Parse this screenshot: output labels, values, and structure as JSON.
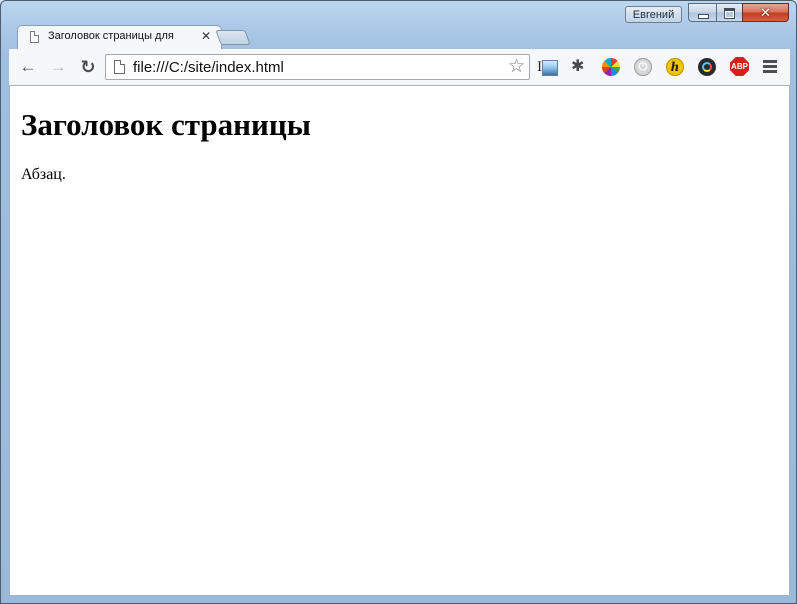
{
  "window": {
    "profile_name": "Евгений",
    "close_glyph": "✕"
  },
  "tabs": [
    {
      "title": "Заголовок страницы для",
      "active": true
    }
  ],
  "toolbar": {
    "back_glyph": "←",
    "forward_glyph": "→",
    "reload_glyph": "↻",
    "url": "file:///C:/site/index.html",
    "bookmark_glyph": "☆",
    "extensions": [
      "image-icon",
      "bug-icon",
      "color-wheel-icon",
      "power-icon",
      "hint-icon",
      "circle-icon",
      "adblock-icon"
    ],
    "abp_label": "ABP",
    "hint_label": "h"
  },
  "page": {
    "heading": "Заголовок страницы",
    "paragraph": "Абзац."
  },
  "colors": {
    "frame": "#a9c7e6",
    "close_button": "#c43e22",
    "abp_red": "#d71f1f"
  }
}
